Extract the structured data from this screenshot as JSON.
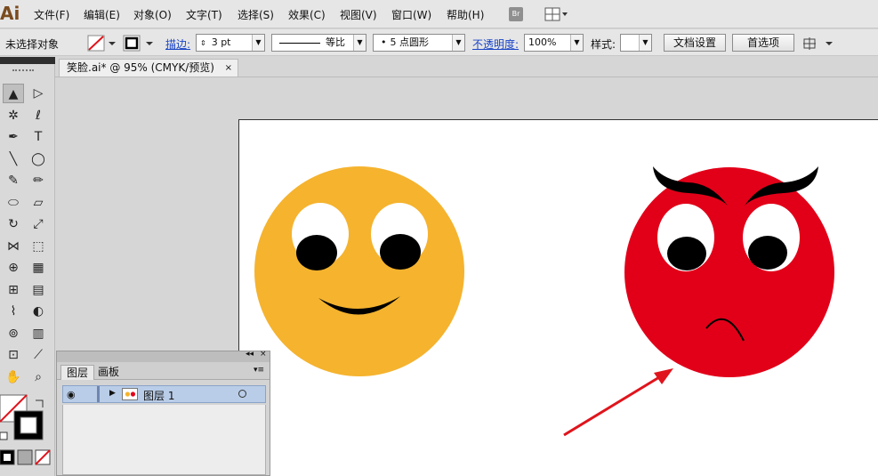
{
  "app": {
    "logo": "Ai"
  },
  "menu": {
    "items": [
      "文件(F)",
      "编辑(E)",
      "对象(O)",
      "文字(T)",
      "选择(S)",
      "效果(C)",
      "视图(V)",
      "窗口(W)",
      "帮助(H)"
    ],
    "bridge_label": "Br"
  },
  "control": {
    "selection_status": "未选择对象",
    "stroke_label": "描边:",
    "stroke_weight": "3 pt",
    "profile_label": "等比",
    "brush_label": "5 点圆形",
    "opacity_label": "不透明度:",
    "opacity_value": "100%",
    "style_label": "样式:",
    "doc_setup_button": "文档设置",
    "preferences_button": "首选项"
  },
  "document": {
    "tab_title": "笑脸.ai* @ 95% (CMYK/预览)",
    "close_glyph": "×"
  },
  "tools": [
    {
      "name": "selection-tool",
      "glyph": "▲"
    },
    {
      "name": "direct-selection-tool",
      "glyph": "▷"
    },
    {
      "name": "magic-wand-tool",
      "glyph": "✲"
    },
    {
      "name": "lasso-tool",
      "glyph": "ℓ"
    },
    {
      "name": "pen-tool",
      "glyph": "✒"
    },
    {
      "name": "type-tool",
      "glyph": "T"
    },
    {
      "name": "line-tool",
      "glyph": "╲"
    },
    {
      "name": "ellipse-tool",
      "glyph": "◯"
    },
    {
      "name": "paintbrush-tool",
      "glyph": "✎"
    },
    {
      "name": "pencil-tool",
      "glyph": "✏"
    },
    {
      "name": "blob-brush-tool",
      "glyph": "⬭"
    },
    {
      "name": "eraser-tool",
      "glyph": "▱"
    },
    {
      "name": "rotate-tool",
      "glyph": "↻"
    },
    {
      "name": "scale-tool",
      "glyph": "⤢"
    },
    {
      "name": "width-tool",
      "glyph": "⋈"
    },
    {
      "name": "free-transform-tool",
      "glyph": "⬚"
    },
    {
      "name": "shape-builder-tool",
      "glyph": "⊕"
    },
    {
      "name": "perspective-grid-tool",
      "glyph": "▦"
    },
    {
      "name": "mesh-tool",
      "glyph": "⊞"
    },
    {
      "name": "gradient-tool",
      "glyph": "▤"
    },
    {
      "name": "eyedropper-tool",
      "glyph": "⌇"
    },
    {
      "name": "blend-tool",
      "glyph": "◐"
    },
    {
      "name": "symbol-sprayer-tool",
      "glyph": "⊚"
    },
    {
      "name": "column-graph-tool",
      "glyph": "▥"
    },
    {
      "name": "artboard-tool",
      "glyph": "⊡"
    },
    {
      "name": "slice-tool",
      "glyph": "⟋"
    },
    {
      "name": "hand-tool",
      "glyph": "✋"
    },
    {
      "name": "zoom-tool",
      "glyph": "⌕"
    }
  ],
  "layers_panel": {
    "tab_layers": "图层",
    "tab_artboards": "画板",
    "collapse_glyph": "◂◂",
    "close_glyph": "×",
    "menu_glyph": "▾≡",
    "layer_name": "图层 1"
  },
  "colors": {
    "happy_face": "#f5b32e",
    "angry_face": "#e20019",
    "eye_white": "#ffffff",
    "pupil": "#000000",
    "arrow": "#e0141c"
  }
}
